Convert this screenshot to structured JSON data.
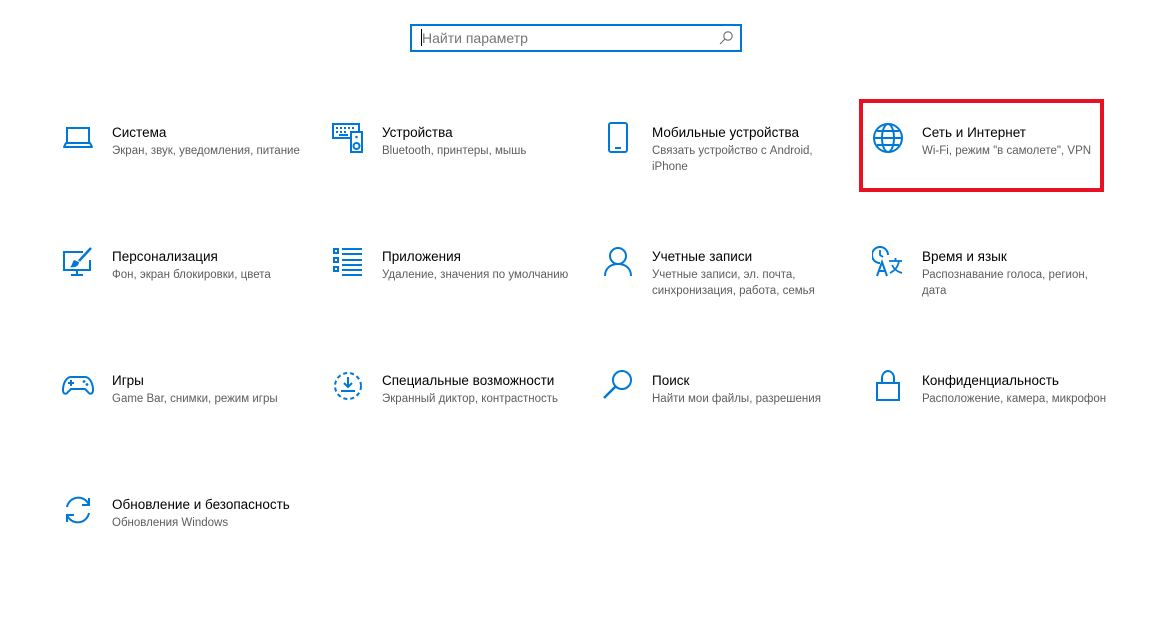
{
  "search": {
    "placeholder": "Найти параметр"
  },
  "accent_color": "#0078d7",
  "highlight_color": "#e81123",
  "tiles": [
    {
      "title": "Система",
      "description": "Экран, звук, уведомления, питание",
      "icon": "laptop-icon"
    },
    {
      "title": "Устройства",
      "description": "Bluetooth, принтеры, мышь",
      "icon": "keyboard-speaker-icon"
    },
    {
      "title": "Мобильные устройства",
      "description": "Связать устройство с Android, iPhone",
      "icon": "phone-icon"
    },
    {
      "title": "Сеть и Интернет",
      "description": "Wi-Fi, режим \"в самолете\", VPN",
      "icon": "globe-icon"
    },
    {
      "title": "Персонализация",
      "description": "Фон, экран блокировки, цвета",
      "icon": "paint-monitor-icon"
    },
    {
      "title": "Приложения",
      "description": "Удаление, значения по умолчанию",
      "icon": "apps-list-icon"
    },
    {
      "title": "Учетные записи",
      "description": "Учетные записи, эл. почта, синхронизация, работа, семья",
      "icon": "person-icon"
    },
    {
      "title": "Время и язык",
      "description": "Распознавание голоса, регион, дата",
      "icon": "time-language-icon"
    },
    {
      "title": "Игры",
      "description": "Game Bar, снимки, режим игры",
      "icon": "gamepad-icon"
    },
    {
      "title": "Специальные возможности",
      "description": "Экранный диктор, контрастность",
      "icon": "ease-of-access-icon"
    },
    {
      "title": "Поиск",
      "description": "Найти мои файлы, разрешения",
      "icon": "magnifier-icon"
    },
    {
      "title": "Конфиденциальность",
      "description": "Расположение, камера, микрофон",
      "icon": "lock-icon"
    },
    {
      "title": "Обновление и безопасность",
      "description": "Обновления Windows",
      "icon": "sync-icon"
    }
  ]
}
